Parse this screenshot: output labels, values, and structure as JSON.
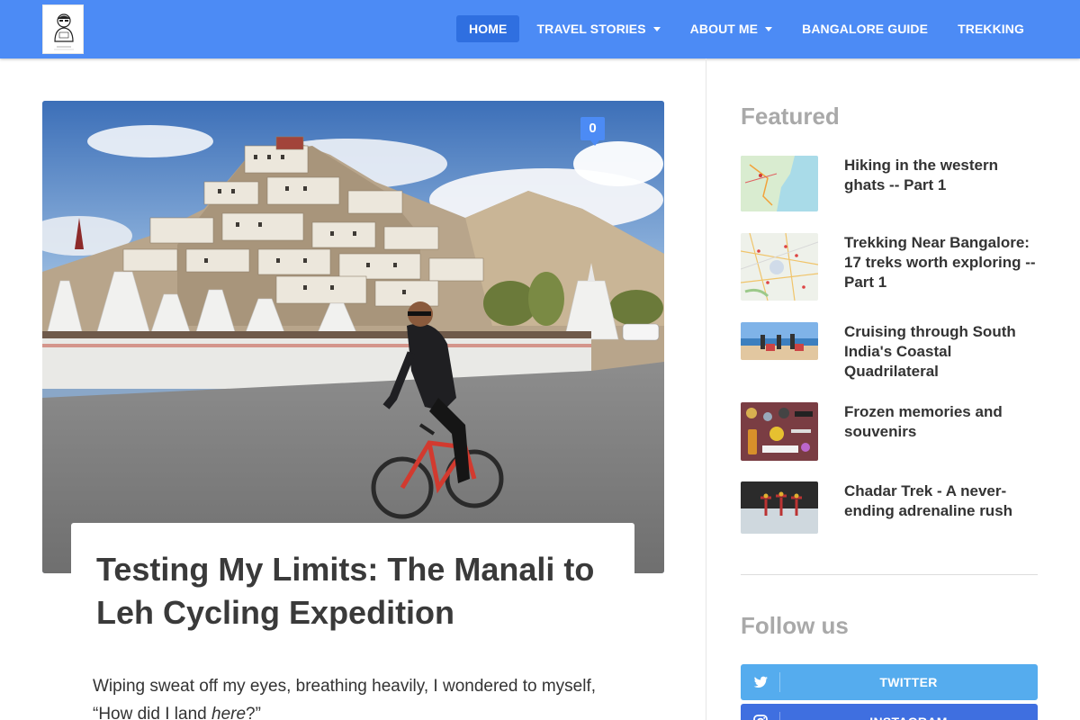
{
  "site": {
    "logo_icon": "avatar-logo"
  },
  "nav": {
    "items": [
      {
        "label": "HOME",
        "active": true,
        "has_dropdown": false
      },
      {
        "label": "TRAVEL STORIES",
        "active": false,
        "has_dropdown": true
      },
      {
        "label": "ABOUT ME",
        "active": false,
        "has_dropdown": true
      },
      {
        "label": "BANGALORE GUIDE",
        "active": false,
        "has_dropdown": false
      },
      {
        "label": "TREKKING",
        "active": false,
        "has_dropdown": false
      }
    ]
  },
  "post": {
    "comment_count": "0",
    "title": "Testing My Limits: The Manali to Leh Cycling Expedition",
    "excerpt_before": "Wiping sweat off my eyes, breathing heavily, I wondered to myself, “How did I land ",
    "excerpt_em": "here",
    "excerpt_after": "?”"
  },
  "sidebar": {
    "featured_title": "Featured",
    "featured": [
      {
        "title": "Hiking in the western ghats -- Part 1",
        "thumb": "map"
      },
      {
        "title": "Trekking Near Bangalore: 17 treks worth exploring -- Part 1",
        "thumb": "map-detailed"
      },
      {
        "title": "Cruising through South India's Coastal Quadrilateral",
        "thumb": "beach"
      },
      {
        "title": "Frozen memories and souvenirs",
        "thumb": "souvenirs"
      },
      {
        "title": "Chadar Trek - A never-ending adrenaline rush",
        "thumb": "ice"
      }
    ],
    "follow_title": "Follow us",
    "social": [
      {
        "label": "TWITTER",
        "icon": "twitter-icon",
        "color": "#55acee"
      },
      {
        "label": "INSTAGRAM",
        "icon": "instagram-icon",
        "color": "#3f6fe0"
      }
    ]
  },
  "colors": {
    "header": "#4c8bf5",
    "nav_active": "#2f6fe0",
    "widget_title": "#a9a9a9"
  }
}
